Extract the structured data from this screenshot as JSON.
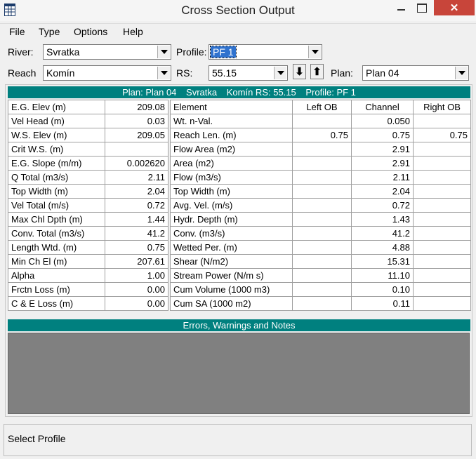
{
  "window": {
    "title": "Cross Section Output",
    "close_glyph": "✕"
  },
  "menu": [
    "File",
    "Type",
    "Options",
    "Help"
  ],
  "selectors": {
    "river_label": "River:",
    "river_value": "Svratka",
    "profile_label": "Profile:",
    "profile_value": "PF 1",
    "reach_label": "Reach",
    "reach_value": "Komín",
    "rs_label": "RS:",
    "rs_value": "55.15",
    "plan_label": "Plan:",
    "plan_value": "Plan 04",
    "down_glyph": "⬇",
    "up_glyph": "⬆"
  },
  "header_bar": {
    "plan": "Plan: Plan 04",
    "river": "Svratka",
    "reach_rs": "Komín  RS: 55.15",
    "profile": "Profile: PF 1"
  },
  "left_table": [
    [
      "E.G. Elev (m)",
      "209.08"
    ],
    [
      "Vel Head (m)",
      "0.03"
    ],
    [
      "W.S. Elev (m)",
      "209.05"
    ],
    [
      "Crit W.S. (m)",
      ""
    ],
    [
      "E.G. Slope (m/m)",
      "0.002620"
    ],
    [
      "Q Total (m3/s)",
      "2.11"
    ],
    [
      "Top Width (m)",
      "2.04"
    ],
    [
      "Vel Total (m/s)",
      "0.72"
    ],
    [
      "Max Chl Dpth (m)",
      "1.44"
    ],
    [
      "Conv. Total (m3/s)",
      "41.2"
    ],
    [
      "Length Wtd. (m)",
      "0.75"
    ],
    [
      "Min Ch El (m)",
      "207.61"
    ],
    [
      "Alpha",
      "1.00"
    ],
    [
      "Frctn Loss (m)",
      "0.00"
    ],
    [
      "C & E Loss (m)",
      "0.00"
    ]
  ],
  "right_table": {
    "headers": [
      "Element",
      "Left OB",
      "Channel",
      "Right OB"
    ],
    "rows": [
      [
        "Wt. n-Val.",
        "",
        "0.050",
        ""
      ],
      [
        "Reach Len. (m)",
        "0.75",
        "0.75",
        "0.75"
      ],
      [
        "Flow Area (m2)",
        "",
        "2.91",
        ""
      ],
      [
        "Area (m2)",
        "",
        "2.91",
        ""
      ],
      [
        "Flow (m3/s)",
        "",
        "2.11",
        ""
      ],
      [
        "Top Width (m)",
        "",
        "2.04",
        ""
      ],
      [
        "Avg. Vel. (m/s)",
        "",
        "0.72",
        ""
      ],
      [
        "Hydr. Depth (m)",
        "",
        "1.43",
        ""
      ],
      [
        "Conv. (m3/s)",
        "",
        "41.2",
        ""
      ],
      [
        "Wetted Per. (m)",
        "",
        "4.88",
        ""
      ],
      [
        "Shear (N/m2)",
        "",
        "15.31",
        ""
      ],
      [
        "Stream Power (N/m s)",
        "",
        "11.10",
        ""
      ],
      [
        "Cum Volume (1000 m3)",
        "",
        "0.10",
        ""
      ],
      [
        "Cum SA (1000 m2)",
        "",
        "0.11",
        ""
      ]
    ]
  },
  "errors_bar": "Errors, Warnings and Notes",
  "status": "Select Profile",
  "colors": {
    "accent_bar": "#00807f",
    "selection": "#2f72ce",
    "close": "#c8453a",
    "notes_bg": "#808080"
  }
}
